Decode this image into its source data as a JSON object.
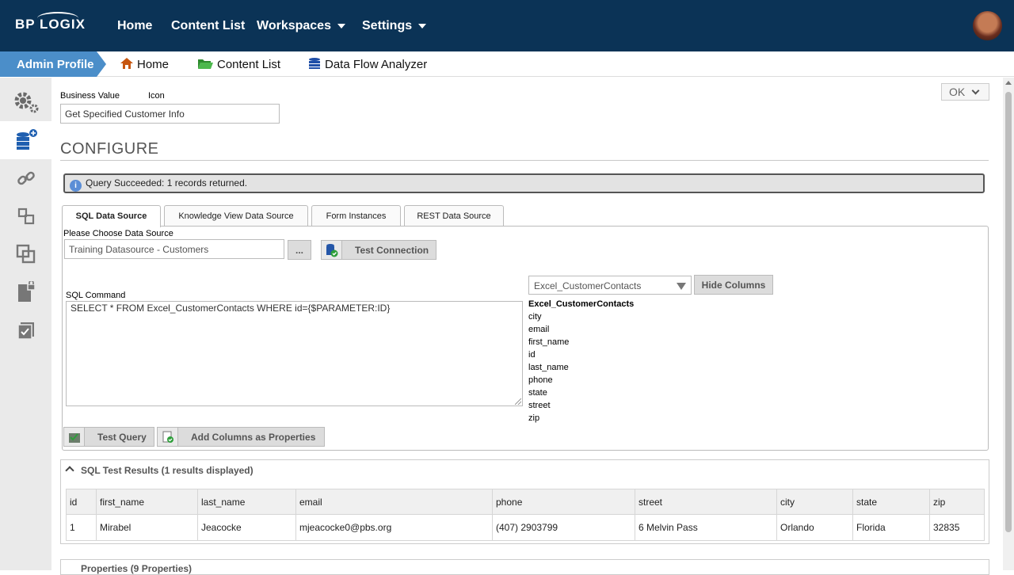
{
  "brand": {
    "logo": "BP LOGIX"
  },
  "topnav": [
    {
      "label": "Home"
    },
    {
      "label": "Content List"
    },
    {
      "label": "Workspaces"
    },
    {
      "label": "Settings"
    }
  ],
  "breadcrumb": {
    "active": "Admin Profile",
    "items": [
      {
        "label": "Home",
        "icon": "home-icon"
      },
      {
        "label": "Content List",
        "icon": "folder-icon"
      },
      {
        "label": "Data Flow Analyzer",
        "icon": "database-icon"
      }
    ]
  },
  "ok_button": "OK",
  "business_value_label": "Business Value",
  "icon_label": "Icon",
  "business_value": "Get Specified Customer Info",
  "section_title": "CONFIGURE",
  "alert": "Query Succeeded: 1 records returned.",
  "tabs": [
    {
      "label": "SQL Data Source",
      "active": true
    },
    {
      "label": "Knowledge View Data Source"
    },
    {
      "label": "Form Instances"
    },
    {
      "label": "REST Data Source"
    }
  ],
  "datasource": {
    "label": "Please Choose Data Source",
    "value": "Training Datasource - Customers",
    "browse": "...",
    "test_connection": "Test Connection"
  },
  "sql": {
    "label": "SQL Command",
    "command": "SELECT * FROM Excel_CustomerContacts WHERE id={$PARAMETER:ID}",
    "test_query": "Test Query",
    "add_columns": "Add Columns as Properties"
  },
  "table_select": {
    "value": "Excel_CustomerContacts",
    "hide_columns": "Hide Columns"
  },
  "columns_list": {
    "table": "Excel_CustomerContacts",
    "columns": [
      "city",
      "email",
      "first_name",
      "id",
      "last_name",
      "phone",
      "state",
      "street",
      "zip"
    ]
  },
  "results": {
    "title": "SQL Test Results (1 results displayed)",
    "headers": [
      "id",
      "first_name",
      "last_name",
      "email",
      "phone",
      "street",
      "city",
      "state",
      "zip"
    ],
    "rows": [
      [
        "1",
        "Mirabel",
        "Jeacocke",
        "mjeacocke0@pbs.org",
        "(407) 2903799",
        "6 Melvin Pass",
        "Orlando",
        "Florida",
        "32835"
      ]
    ]
  },
  "properties": {
    "title": "Properties (9 Properties)"
  }
}
